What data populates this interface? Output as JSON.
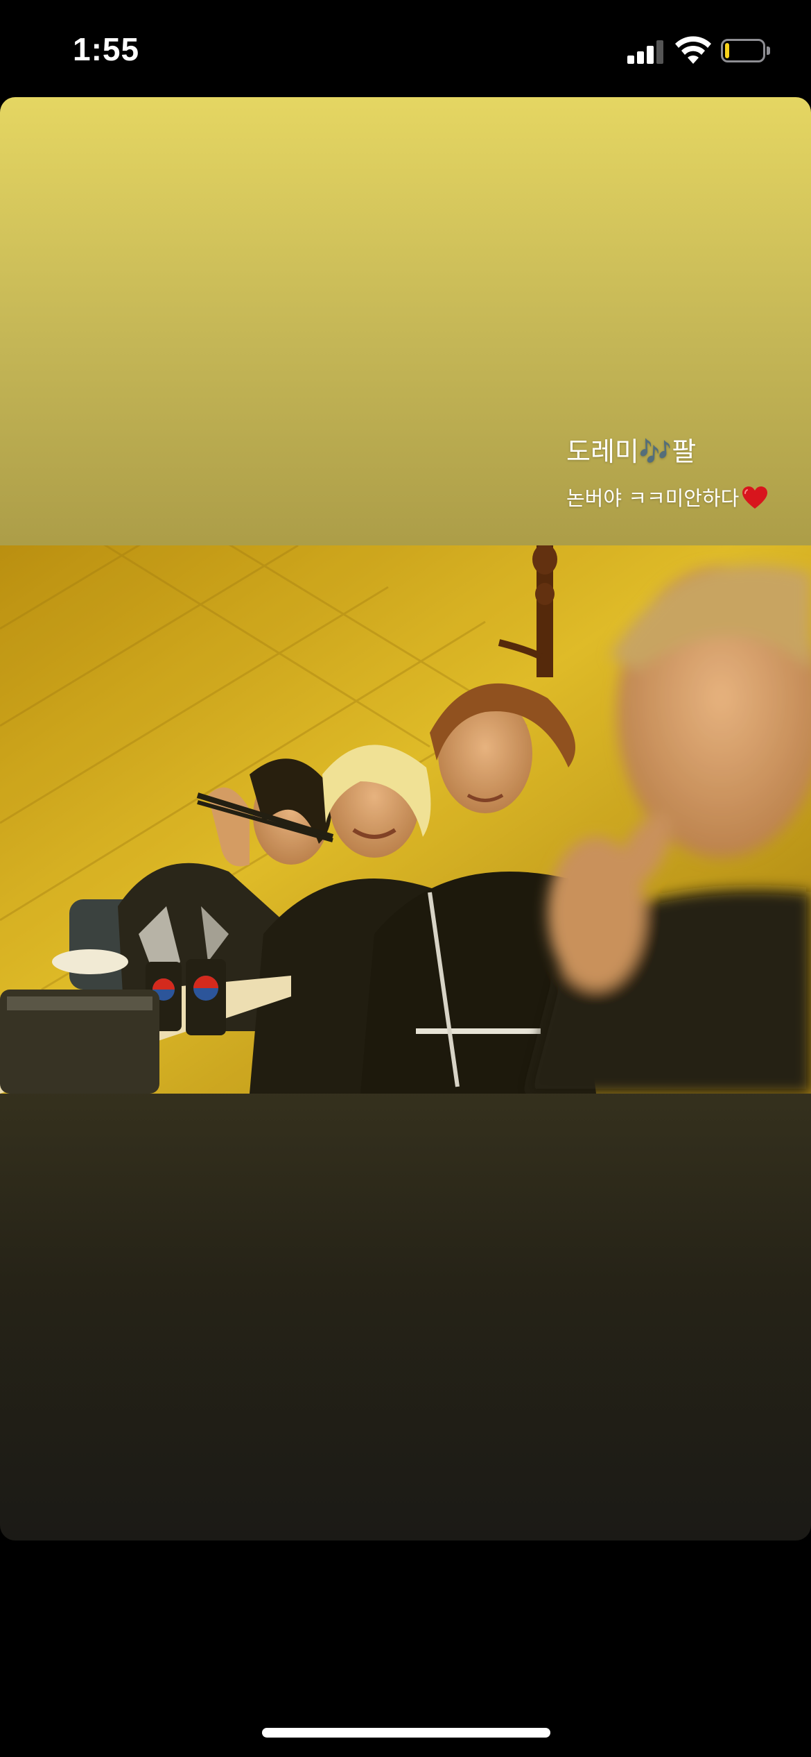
{
  "status_bar": {
    "time": "1:55",
    "signal_icon": "cellular-signal-icon",
    "wifi_icon": "wifi-icon",
    "battery_icon": "battery-icon",
    "battery_level": 0.12,
    "battery_color": "#f7d21b"
  },
  "story": {
    "caption_line1": "도레미🎶팔",
    "caption_line2": "논버야 ㅋㅋ미안하다",
    "caption_emoji_icon": "red-heart-icon",
    "photo": "group-photo-at-restaurant",
    "gradient_top_color": "#e5d662",
    "gradient_bottom_color": "#1b1a16"
  },
  "home_indicator": "home-indicator-bar"
}
